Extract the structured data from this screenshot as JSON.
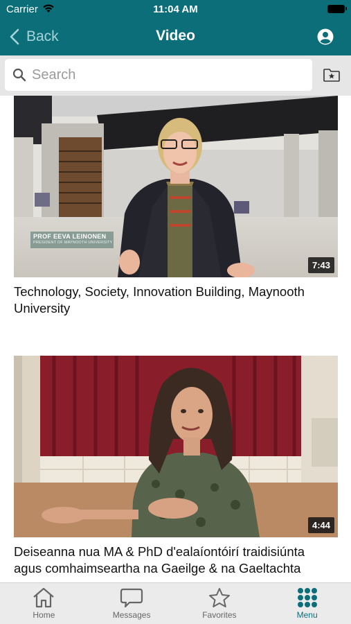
{
  "status_bar": {
    "carrier": "Carrier",
    "time": "11:04 AM"
  },
  "header": {
    "back_label": "Back",
    "title": "Video"
  },
  "search": {
    "placeholder": "Search"
  },
  "videos": [
    {
      "title": "Technology, Society, Innovation Building, Maynooth University",
      "duration": "7:43",
      "caption_name": "PROF EEVA LEINONEN",
      "caption_role": "PRESIDENT OF MAYNOOTH UNIVERSITY"
    },
    {
      "title": "Deiseanna nua MA & PhD d'ealaíontóirí traidisiúnta agus comhaimseartha na Gaeilge & na Gaeltachta",
      "duration": "4:44"
    }
  ],
  "tabbar": {
    "items": [
      {
        "label": "Home",
        "icon": "home-icon"
      },
      {
        "label": "Messages",
        "icon": "chat-icon"
      },
      {
        "label": "Favorites",
        "icon": "star-icon"
      },
      {
        "label": "Menu",
        "icon": "grid-icon",
        "active": true
      }
    ]
  },
  "colors": {
    "brand": "#0b6e79",
    "back_text": "#a7d4db",
    "tab_inactive": "#666666",
    "search_bg": "#e6e6e6"
  }
}
